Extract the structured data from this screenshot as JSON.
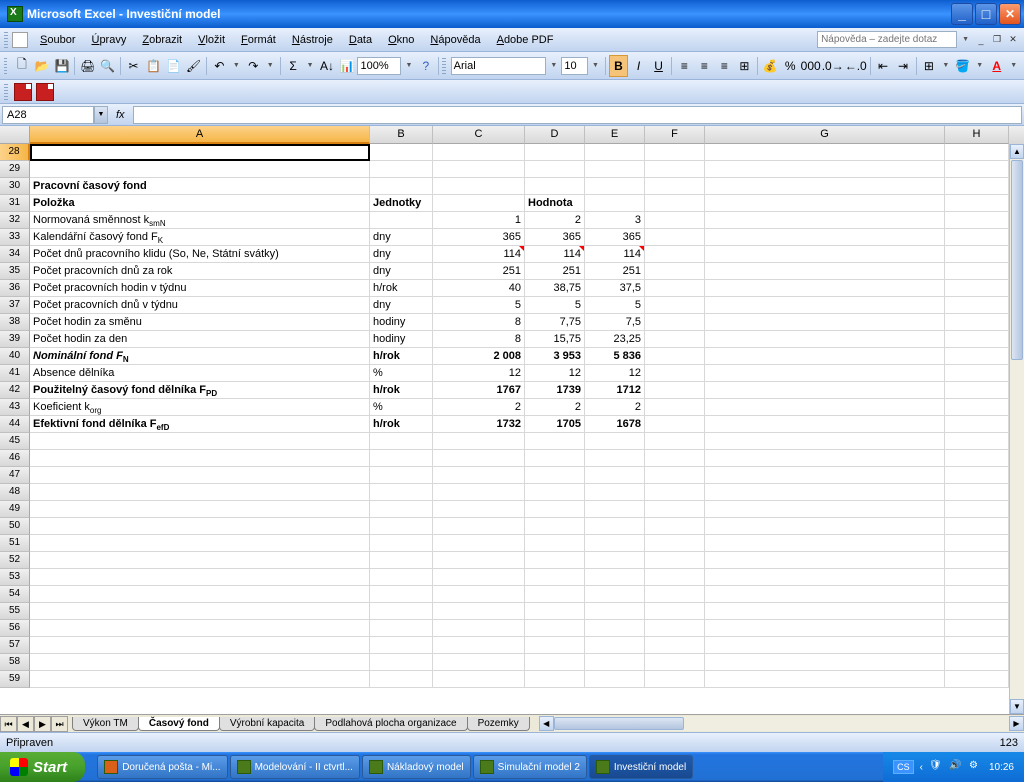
{
  "titlebar": {
    "app": "Microsoft Excel",
    "doc": "Investiční model"
  },
  "menu": [
    "Soubor",
    "Úpravy",
    "Zobrazit",
    "Vložit",
    "Formát",
    "Nástroje",
    "Data",
    "Okno",
    "Nápověda",
    "Adobe PDF"
  ],
  "help_placeholder": "Nápověda – zadejte dotaz",
  "toolbar": {
    "zoom": "100%",
    "font": "Arial",
    "size": "10"
  },
  "namebox": "A28",
  "fx": "fx",
  "cols": [
    "A",
    "B",
    "C",
    "D",
    "E",
    "F",
    "G",
    "H"
  ],
  "row_start": 28,
  "row_count": 32,
  "rows": {
    "30": {
      "A": {
        "t": "Pracovní časový fond",
        "b": true
      }
    },
    "31": {
      "A": {
        "t": "Položka",
        "b": true
      },
      "B": {
        "t": "Jednotky",
        "b": true
      },
      "D": {
        "t": "Hodnota",
        "b": true
      }
    },
    "32": {
      "A": {
        "t": "Normovaná směnnost k",
        "sub": "smN"
      },
      "C": {
        "t": "1",
        "r": true
      },
      "D": {
        "t": "2",
        "r": true
      },
      "E": {
        "t": "3",
        "r": true
      }
    },
    "33": {
      "A": {
        "t": "Kalendářní časový fond F",
        "sub": "K"
      },
      "B": {
        "t": "dny"
      },
      "C": {
        "t": "365",
        "r": true
      },
      "D": {
        "t": "365",
        "r": true
      },
      "E": {
        "t": "365",
        "r": true
      }
    },
    "34": {
      "A": {
        "t": "Počet dnů pracovního klidu (So, Ne, Státní svátky)"
      },
      "B": {
        "t": "dny"
      },
      "C": {
        "t": "114",
        "r": true,
        "tri": true
      },
      "D": {
        "t": "114",
        "r": true,
        "tri": true
      },
      "E": {
        "t": "114",
        "r": true,
        "tri": true
      }
    },
    "35": {
      "A": {
        "t": "Počet pracovních dnů za rok"
      },
      "B": {
        "t": "dny"
      },
      "C": {
        "t": "251",
        "r": true
      },
      "D": {
        "t": "251",
        "r": true
      },
      "E": {
        "t": "251",
        "r": true
      }
    },
    "36": {
      "A": {
        "t": "Počet pracovních hodin v týdnu"
      },
      "B": {
        "t": "h/rok"
      },
      "C": {
        "t": "40",
        "r": true
      },
      "D": {
        "t": "38,75",
        "r": true
      },
      "E": {
        "t": "37,5",
        "r": true
      }
    },
    "37": {
      "A": {
        "t": "Počet pracovních dnů v týdnu"
      },
      "B": {
        "t": "dny"
      },
      "C": {
        "t": "5",
        "r": true
      },
      "D": {
        "t": "5",
        "r": true
      },
      "E": {
        "t": "5",
        "r": true
      }
    },
    "38": {
      "A": {
        "t": "Počet hodin za směnu"
      },
      "B": {
        "t": "hodiny"
      },
      "C": {
        "t": "8",
        "r": true
      },
      "D": {
        "t": "7,75",
        "r": true
      },
      "E": {
        "t": "7,5",
        "r": true
      }
    },
    "39": {
      "A": {
        "t": "Počet hodin za den"
      },
      "B": {
        "t": "hodiny"
      },
      "C": {
        "t": "8",
        "r": true
      },
      "D": {
        "t": "15,75",
        "r": true
      },
      "E": {
        "t": "23,25",
        "r": true
      }
    },
    "40": {
      "A": {
        "t": "Nominální fond F",
        "sub": "N",
        "b": true,
        "i": true
      },
      "B": {
        "t": "h/rok",
        "b": true
      },
      "C": {
        "t": "2 008",
        "r": true,
        "b": true
      },
      "D": {
        "t": "3 953",
        "r": true,
        "b": true
      },
      "E": {
        "t": "5 836",
        "r": true,
        "b": true
      }
    },
    "41": {
      "A": {
        "t": "Absence dělníka"
      },
      "B": {
        "t": "%"
      },
      "C": {
        "t": "12",
        "r": true
      },
      "D": {
        "t": "12",
        "r": true
      },
      "E": {
        "t": "12",
        "r": true
      }
    },
    "42": {
      "A": {
        "t": "Použitelný časový fond dělníka F",
        "sub": "PD",
        "b": true
      },
      "B": {
        "t": "h/rok",
        "b": true
      },
      "C": {
        "t": "1767",
        "r": true,
        "b": true
      },
      "D": {
        "t": "1739",
        "r": true,
        "b": true
      },
      "E": {
        "t": "1712",
        "r": true,
        "b": true
      }
    },
    "43": {
      "A": {
        "t": "Koeficient k",
        "sub": "org"
      },
      "B": {
        "t": "%"
      },
      "C": {
        "t": "2",
        "r": true
      },
      "D": {
        "t": "2",
        "r": true
      },
      "E": {
        "t": "2",
        "r": true
      }
    },
    "44": {
      "A": {
        "t": "Efektivní fond dělníka F",
        "sub": "efD",
        "b": true
      },
      "B": {
        "t": "h/rok",
        "b": true
      },
      "C": {
        "t": "1732",
        "r": true,
        "b": true
      },
      "D": {
        "t": "1705",
        "r": true,
        "b": true
      },
      "E": {
        "t": "1678",
        "r": true,
        "b": true
      }
    }
  },
  "tabs": [
    "Výkon TM",
    "Časový fond",
    "Výrobní kapacita",
    "Podlahová plocha organizace",
    "Pozemky"
  ],
  "active_tab": 1,
  "status": {
    "left": "Připraven",
    "right": "123"
  },
  "start": "Start",
  "task_items": [
    "Doručená pošta - Mi...",
    "Modelování - II ctvrtl...",
    "Nákladový model",
    "Simulační model 2",
    "Investiční model"
  ],
  "tray": {
    "lang": "CS",
    "time": "10:26"
  }
}
